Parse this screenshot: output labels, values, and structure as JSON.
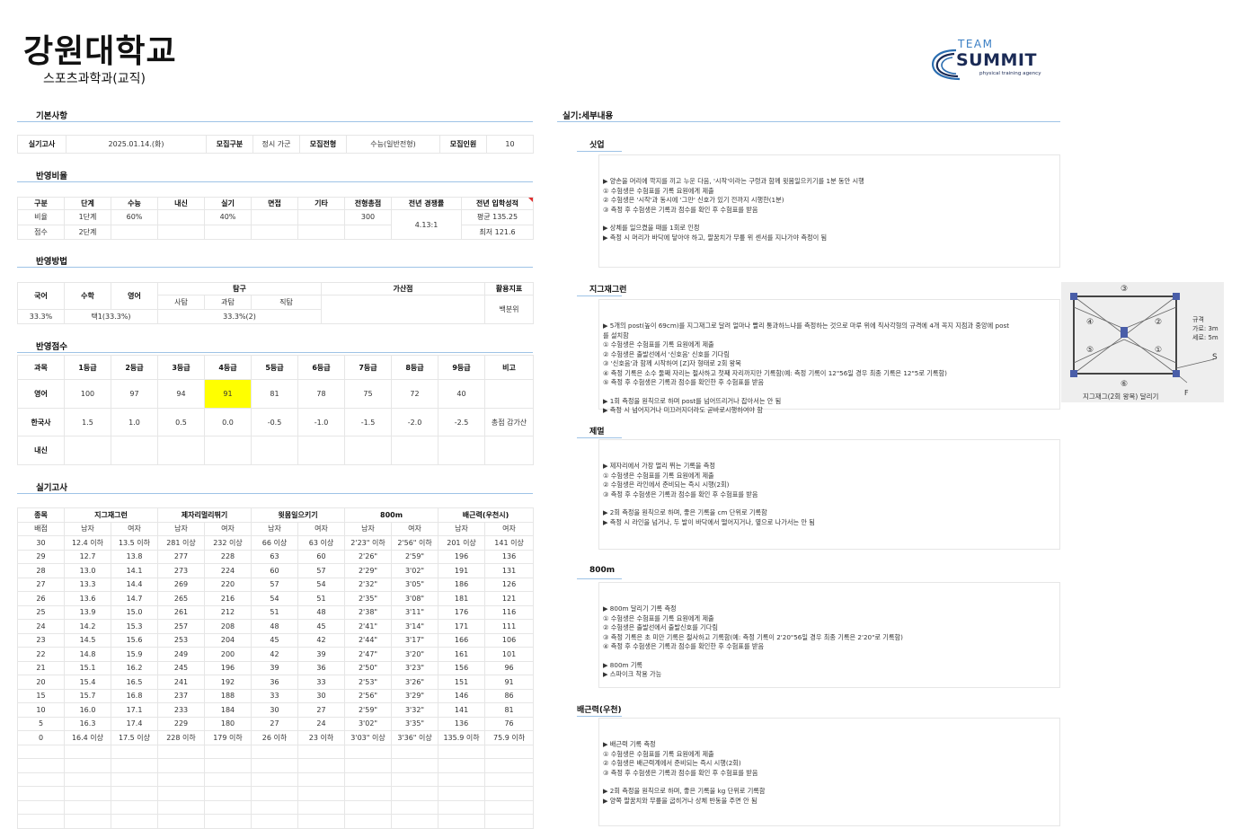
{
  "header": {
    "university": "강원대학교",
    "department": "스포츠과학과(교직)"
  },
  "logo": {
    "team": "TEAM",
    "summit": "SUMMIT",
    "tagline": "physical training agency"
  },
  "sections": {
    "basic": "기본사항",
    "ratio": "반영비율",
    "method": "반영방법",
    "score": "반영점수",
    "practical": "실기고사",
    "detail": "실기:세부내용"
  },
  "basic": {
    "exam_date_label": "실기고사",
    "exam_date": "2025.01.14.(화)",
    "recruit_type_label": "모집구분",
    "recruit_type": "정시 가군",
    "recruit_process_label": "모집전형",
    "recruit_process": "수능(일반전형)",
    "recruit_count_label": "모집인원",
    "recruit_count": "10"
  },
  "ratio": {
    "headers": [
      "구분",
      "단계",
      "수능",
      "내신",
      "실기",
      "면접",
      "기타",
      "전형총점",
      "전년 경쟁률",
      "전년 입학성적"
    ],
    "row1": {
      "label": "비율",
      "stage": "1단계",
      "suneung": "60%",
      "silgi": "40%",
      "total": "300"
    },
    "row2": {
      "label": "점수",
      "stage": "2단계"
    },
    "competition": "4.13:1",
    "admission_avg": "평균 135.25",
    "admission_min": "최저 121.6"
  },
  "method": {
    "korean": "국어",
    "math": "수학",
    "english": "영어",
    "explore": "탐구",
    "explore_sub": [
      "사탐",
      "과탐",
      "직탐"
    ],
    "bonus": "가산점",
    "index": "활용지표",
    "korean_val": "33.3%",
    "math_val": "택1(33.3%)",
    "explore_val": "33.3%(2)",
    "index_val": "백분위"
  },
  "score": {
    "headers": [
      "과목",
      "1등급",
      "2등급",
      "3등급",
      "4등급",
      "5등급",
      "6등급",
      "7등급",
      "8등급",
      "9등급",
      "비고"
    ],
    "rows": [
      {
        "subject": "영어",
        "values": [
          "100",
          "97",
          "94",
          "91",
          "81",
          "78",
          "75",
          "72",
          "40"
        ],
        "note": ""
      },
      {
        "subject": "한국사",
        "values": [
          "1.5",
          "1.0",
          "0.5",
          "0.0",
          "-0.5",
          "-1.0",
          "-1.5",
          "-2.0",
          "-2.5"
        ],
        "note": "총점 감가산"
      },
      {
        "subject": "내신",
        "values": [
          "",
          "",
          "",
          "",
          "",
          "",
          "",
          "",
          ""
        ],
        "note": ""
      }
    ]
  },
  "practical": {
    "item_label": "종목",
    "score_label": "배점",
    "events": [
      "지그재그런",
      "제자리멀리뛰기",
      "윗몸일으키기",
      "800m",
      "배근력(우천시)"
    ],
    "male": "남자",
    "female": "여자",
    "rows": [
      [
        "30",
        "12.4 이하",
        "13.5 이하",
        "281 이상",
        "232 이상",
        "66 이상",
        "63 이상",
        "2'23\" 이하",
        "2'56\" 이하",
        "201 이상",
        "141 이상"
      ],
      [
        "29",
        "12.7",
        "13.8",
        "277",
        "228",
        "63",
        "60",
        "2'26\"",
        "2'59\"",
        "196",
        "136"
      ],
      [
        "28",
        "13.0",
        "14.1",
        "273",
        "224",
        "60",
        "57",
        "2'29\"",
        "3'02\"",
        "191",
        "131"
      ],
      [
        "27",
        "13.3",
        "14.4",
        "269",
        "220",
        "57",
        "54",
        "2'32\"",
        "3'05\"",
        "186",
        "126"
      ],
      [
        "26",
        "13.6",
        "14.7",
        "265",
        "216",
        "54",
        "51",
        "2'35\"",
        "3'08\"",
        "181",
        "121"
      ],
      [
        "25",
        "13.9",
        "15.0",
        "261",
        "212",
        "51",
        "48",
        "2'38\"",
        "3'11\"",
        "176",
        "116"
      ],
      [
        "24",
        "14.2",
        "15.3",
        "257",
        "208",
        "48",
        "45",
        "2'41\"",
        "3'14\"",
        "171",
        "111"
      ],
      [
        "23",
        "14.5",
        "15.6",
        "253",
        "204",
        "45",
        "42",
        "2'44\"",
        "3'17\"",
        "166",
        "106"
      ],
      [
        "22",
        "14.8",
        "15.9",
        "249",
        "200",
        "42",
        "39",
        "2'47\"",
        "3'20\"",
        "161",
        "101"
      ],
      [
        "21",
        "15.1",
        "16.2",
        "245",
        "196",
        "39",
        "36",
        "2'50\"",
        "3'23\"",
        "156",
        "96"
      ],
      [
        "20",
        "15.4",
        "16.5",
        "241",
        "192",
        "36",
        "33",
        "2'53\"",
        "3'26\"",
        "151",
        "91"
      ],
      [
        "15",
        "15.7",
        "16.8",
        "237",
        "188",
        "33",
        "30",
        "2'56\"",
        "3'29\"",
        "146",
        "86"
      ],
      [
        "10",
        "16.0",
        "17.1",
        "233",
        "184",
        "30",
        "27",
        "2'59\"",
        "3'32\"",
        "141",
        "81"
      ],
      [
        "5",
        "16.3",
        "17.4",
        "229",
        "180",
        "27",
        "24",
        "3'02\"",
        "3'35\"",
        "136",
        "76"
      ],
      [
        "0",
        "16.4 이상",
        "17.5 이상",
        "228 이하",
        "179 이하",
        "26 이하",
        "23 이하",
        "3'03\" 이상",
        "3'36\" 이상",
        "135.9 이하",
        "75.9 이하"
      ]
    ]
  },
  "details": [
    {
      "title": "싯업",
      "lines": [
        "▶ 양손을 머리에 깍지를 끼고 누운 다음, '시작'이라는 구령과 함께 윗몸일으키기를 1분 동안 시행",
        "① 수험생은 수험표를 기록 요원에게 제출",
        "② 수험생은 '시작'과 동시에 '그만' 신호가 있기 전까지 시행한(1분)",
        "③ 측정 후 수험생은 기록과 점수를 확인 후 수험표를 받음",
        "",
        "▶ 상체를 일으켰을 때를 1회로 인정",
        "▶ 측정 시 머리가 바닥에 닿아야 하고, 팔꿈치가 무릎 위 센서를 지나가야 측정이 됨"
      ]
    },
    {
      "title": "지그재그런",
      "lines": [
        "▶ 5개의 post(높이 69cm)를 지그재그로 달려 얼마나 빨리 통과하느냐를 측정하는 것으로 마루 위에 직사각형의 규격에 4개 꼭지 지점과 중앙에 post",
        "를 설치함",
        "① 수험생은 수험표를 기록 요원에게 제출",
        "② 수험생은 출발선에서 '신호음' 신호를 기다림",
        "③ '신호음'과 함께 시작하여 [Z]자 형태로 2회 왕복",
        "④ 측정 기록은 소수 둘째 자리는 절사하고 첫째 자리까지만 기록함(예: 측정 기록이 12\"56일 경우 최종 기록은 12\"5로 기록함)",
        "⑤ 측정 후 수험생은 기록과 점수를 확인한 후 수험표를 받음",
        "",
        "▶ 1회 측정을 원칙으로 하며 post를 넘어뜨리거나 잡아서는 안 됨",
        "▶ 측정 시 넘어지거나 미끄러지더라도 곧바로시행하여야 함"
      ]
    },
    {
      "title": "제멀",
      "lines": [
        "▶ 제자리에서 가장 멀리 뛰는 기록을 측정",
        "① 수험생은 수험표를 기록 요원에게 제출",
        "② 수험생은 라인에서 준비되는 즉시 시행(2회)",
        "③ 측정 후 수험생은 기록과 점수를 확인 후 수험표를 받음",
        "",
        "▶ 2회 측정을 원칙으로 하며, 좋은 기록을 cm 단위로 기록함",
        "▶ 측정 시 라인을 넘거나, 두 발이 바닥에서 떨어지거나, 옆으로 나가서는 안 됨"
      ]
    },
    {
      "title": "800m",
      "lines": [
        "▶ 800m 달리기 기록 측정",
        "① 수험생은 수험표를 기록 요원에게 제출",
        "② 수험생은 출발선에서 출발신호를 기다림",
        "③ 측정 기록은 초 미만 기록은 절사하고 기록함(예: 측정 기록이 2'20\"56일 경우 최종 기록은 2'20\"로 기록함)",
        "④ 측정 후 수험생은 기록과 점수를 확인한 후 수험표를 받음",
        "",
        "▶ 800m 기록",
        "▶ 스파이크 착용 가능"
      ]
    },
    {
      "title": "배근력(우천)",
      "lines": [
        "▶ 배근력 기록 측정",
        "① 수험생은 수험표를 기록 요원에게 제출",
        "② 수험생은 배근력계에서 준비되는 즉시 시행(2회)",
        "③ 측정 후 수험생은 기록과 점수를 확인 후 수험표를 받음",
        "",
        "▶ 2회 측정을 원칙으로 하며, 좋은 기록을 kg 단위로 기록함",
        "▶ 양쪽 팔꿈치와 무릎을 굽히거나 상체 반동을 주면 안 됨"
      ]
    }
  ],
  "diagram": {
    "labels": [
      "③",
      "④",
      "②",
      "⑤",
      "①",
      "⑥"
    ],
    "spec_title": "규격",
    "spec_w": "가로: 3m",
    "spec_h": "세로: 5m",
    "s": "S",
    "f": "F",
    "caption": "지그재그(2회 왕복) 달리기"
  }
}
